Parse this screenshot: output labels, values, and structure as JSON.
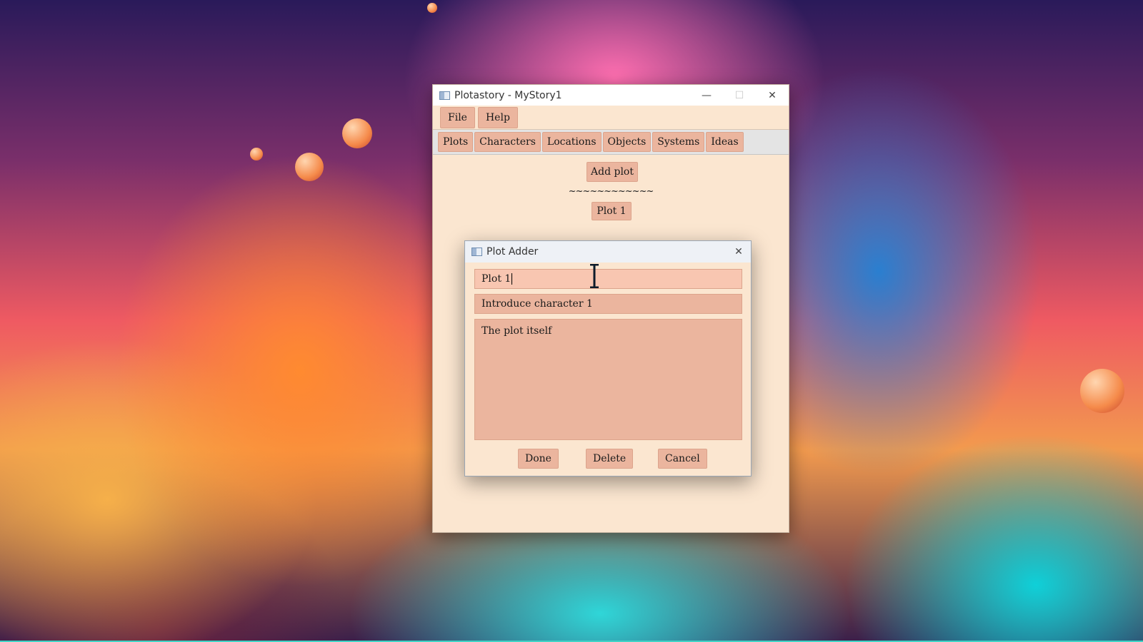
{
  "main_window": {
    "title": "Plotastory - MyStory1",
    "controls": {
      "minimize": "—",
      "maximize": "☐",
      "close": "✕"
    },
    "menu": [
      "File",
      "Help"
    ],
    "tabs": [
      "Plots",
      "Characters",
      "Locations",
      "Objects",
      "Systems",
      "Ideas"
    ],
    "active_tab": "Plots",
    "add_plot_label": "Add plot",
    "divider_text": "~~~~~~~~~~~~",
    "plots": [
      "Plot 1"
    ]
  },
  "dialog": {
    "title": "Plot Adder",
    "close": "✕",
    "name_value": "Plot 1",
    "summary_value": "Introduce character 1",
    "body_value": "The plot itself",
    "buttons": {
      "done": "Done",
      "delete": "Delete",
      "cancel": "Cancel"
    }
  },
  "colors": {
    "window_bg": "#fbe6d0",
    "button_bg": "#ebb59e",
    "focused_field_bg": "#f8c6b1"
  },
  "icons": [
    "app-icon",
    "minimize-icon",
    "maximize-icon",
    "close-icon",
    "text-cursor-icon"
  ]
}
